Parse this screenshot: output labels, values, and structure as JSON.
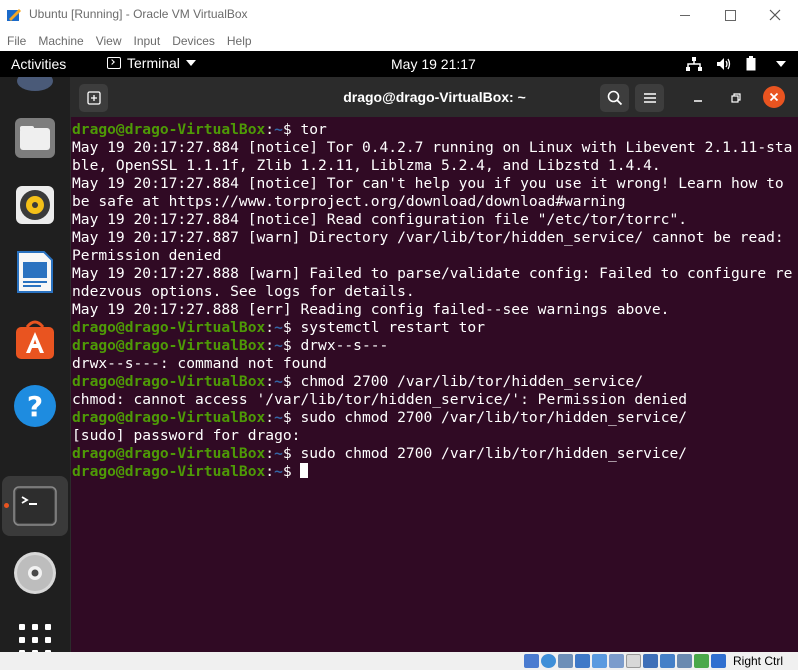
{
  "window": {
    "title": "Ubuntu [Running] - Oracle VM VirtualBox"
  },
  "menubar": {
    "items": [
      "File",
      "Machine",
      "View",
      "Input",
      "Devices",
      "Help"
    ]
  },
  "topbar": {
    "activities": "Activities",
    "app_name": "Terminal",
    "datetime": "May 19  21:17"
  },
  "dock": {
    "items": [
      "files",
      "rhythmbox",
      "libreoffice-writer",
      "ubuntu-software",
      "help",
      "terminal",
      "optical-disc",
      "show-applications"
    ],
    "active": "terminal"
  },
  "terminal": {
    "title": "drago@drago-VirtualBox: ~",
    "prompt_user": "drago@drago-VirtualBox",
    "prompt_sep": ":",
    "prompt_path": "~",
    "prompt_symbol": "$ ",
    "lines": [
      {
        "type": "prompt",
        "cmd": "tor"
      },
      {
        "type": "out",
        "text": "May 19 20:17:27.884 [notice] Tor 0.4.2.7 running on Linux with Libevent 2.1.11-stable, OpenSSL 1.1.1f, Zlib 1.2.11, Liblzma 5.2.4, and Libzstd 1.4.4."
      },
      {
        "type": "out",
        "text": "May 19 20:17:27.884 [notice] Tor can't help you if you use it wrong! Learn how to be safe at https://www.torproject.org/download/download#warning"
      },
      {
        "type": "out",
        "text": "May 19 20:17:27.884 [notice] Read configuration file \"/etc/tor/torrc\"."
      },
      {
        "type": "out",
        "text": "May 19 20:17:27.887 [warn] Directory /var/lib/tor/hidden_service/ cannot be read: Permission denied"
      },
      {
        "type": "out",
        "text": "May 19 20:17:27.888 [warn] Failed to parse/validate config: Failed to configure rendezvous options. See logs for details."
      },
      {
        "type": "out",
        "text": "May 19 20:17:27.888 [err] Reading config failed--see warnings above."
      },
      {
        "type": "prompt",
        "cmd": "systemctl restart tor"
      },
      {
        "type": "prompt",
        "cmd": "drwx--s---"
      },
      {
        "type": "out",
        "text": "drwx--s---: command not found"
      },
      {
        "type": "prompt",
        "cmd": "chmod 2700 /var/lib/tor/hidden_service/"
      },
      {
        "type": "out",
        "text": "chmod: cannot access '/var/lib/tor/hidden_service/': Permission denied"
      },
      {
        "type": "prompt",
        "cmd": "sudo chmod 2700 /var/lib/tor/hidden_service/"
      },
      {
        "type": "out",
        "text": "[sudo] password for drago:"
      },
      {
        "type": "prompt",
        "cmd": "sudo chmod 2700 /var/lib/tor/hidden_service/"
      },
      {
        "type": "prompt",
        "cmd": "",
        "cursor": true
      }
    ]
  },
  "statusbar": {
    "host_key": "Right Ctrl"
  },
  "colors": {
    "terminal_bg": "#300a24",
    "prompt_user": "#4e9a06",
    "prompt_path": "#3465a4",
    "accent": "#e95420"
  }
}
